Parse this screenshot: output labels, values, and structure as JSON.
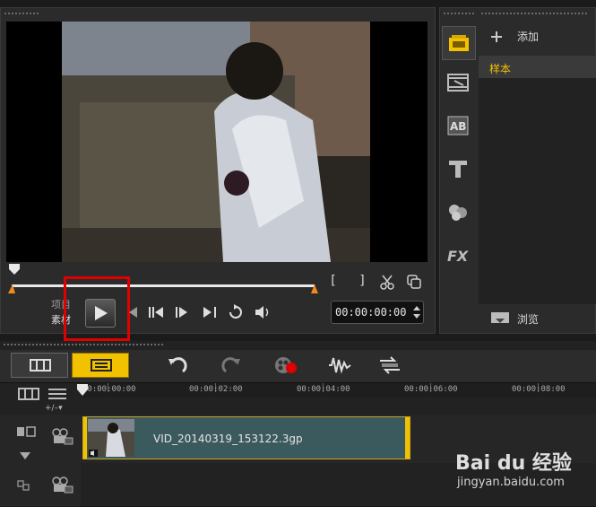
{
  "preview": {
    "mode_project": "项目",
    "mode_clip": "素材",
    "timecode": "00:00:00:00",
    "trim_start": "[",
    "trim_end": "]"
  },
  "library": {
    "add_label": "添加",
    "folder": "样本",
    "browse_label": "浏览"
  },
  "timeline": {
    "ruler_labels": [
      "00:00:00:00",
      "00:00:02:00",
      "00:00:04:00",
      "00:00:06:00",
      "00:00:08:00"
    ],
    "clip_name": "VID_20140319_153122.3gp"
  },
  "watermark": {
    "brand": "Bai du 经验",
    "url": "jingyan.baidu.com"
  },
  "colors": {
    "accent": "#f2c200",
    "scrub": "#f08a1c",
    "highlight": "#e00000"
  },
  "icons": [
    "play-icon",
    "prev-icon",
    "step-back-icon",
    "step-forward-icon",
    "next-icon",
    "repeat-icon",
    "volume-icon",
    "scissors-icon",
    "copy-icon",
    "media-icon",
    "instant-project-icon",
    "title-icon",
    "transition-icon",
    "fx-icon",
    "filter-icon",
    "undo-icon",
    "redo-icon",
    "record-icon",
    "audio-mix-icon",
    "auto-music-icon"
  ]
}
